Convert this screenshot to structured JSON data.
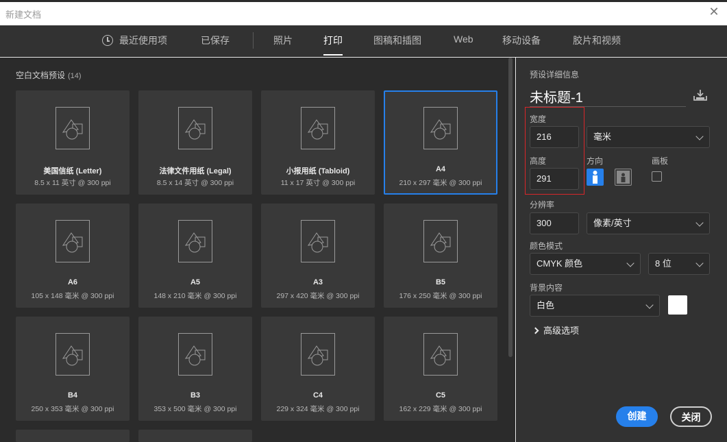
{
  "window": {
    "title": "新建文档",
    "close_icon": "close-icon"
  },
  "tabs": [
    {
      "label": "最近使用项",
      "icon": "clock-icon",
      "active": false
    },
    {
      "label": "已保存",
      "active": false
    },
    {
      "label": "照片",
      "active": false
    },
    {
      "label": "打印",
      "active": true
    },
    {
      "label": "图稿和插图",
      "active": false
    },
    {
      "label": "Web",
      "active": false
    },
    {
      "label": "移动设备",
      "active": false
    },
    {
      "label": "胶片和视频",
      "active": false
    }
  ],
  "presets": {
    "heading": "空白文档预设",
    "count": "(14)",
    "items": [
      {
        "name": "美国信纸 (Letter)",
        "size": "8.5 x 11 英寸 @ 300 ppi",
        "selected": false
      },
      {
        "name": "法律文件用纸 (Legal)",
        "size": "8.5 x 14 英寸 @ 300 ppi",
        "selected": false
      },
      {
        "name": "小报用纸 (Tabloid)",
        "size": "11 x 17 英寸 @ 300 ppi",
        "selected": false
      },
      {
        "name": "A4",
        "size": "210 x 297 毫米 @ 300 ppi",
        "selected": true
      },
      {
        "name": "A6",
        "size": "105 x 148 毫米 @ 300 ppi",
        "selected": false
      },
      {
        "name": "A5",
        "size": "148 x 210 毫米 @ 300 ppi",
        "selected": false
      },
      {
        "name": "A3",
        "size": "297 x 420 毫米 @ 300 ppi",
        "selected": false
      },
      {
        "name": "B5",
        "size": "176 x 250 毫米 @ 300 ppi",
        "selected": false
      },
      {
        "name": "B4",
        "size": "250 x 353 毫米 @ 300 ppi",
        "selected": false
      },
      {
        "name": "B3",
        "size": "353 x 500 毫米 @ 300 ppi",
        "selected": false
      },
      {
        "name": "C4",
        "size": "229 x 324 毫米 @ 300 ppi",
        "selected": false
      },
      {
        "name": "C5",
        "size": "162 x 229 毫米 @ 300 ppi",
        "selected": false
      }
    ]
  },
  "details": {
    "heading": "预设详细信息",
    "doc_name": "未标题-1",
    "width_label": "宽度",
    "width_value": "216",
    "unit": "毫米",
    "height_label": "高度",
    "height_value": "291",
    "orientation_label": "方向",
    "artboard_label": "画板",
    "resolution_label": "分辨率",
    "resolution_value": "300",
    "resolution_unit": "像素/英寸",
    "color_mode_label": "颜色模式",
    "color_mode": "CMYK 颜色",
    "bit_depth": "8 位",
    "background_label": "背景内容",
    "background": "白色",
    "background_color": "#ffffff",
    "advanced": "高级选项"
  },
  "buttons": {
    "create": "创建",
    "close": "关闭"
  },
  "colors": {
    "accent": "#2680eb",
    "highlight_box": "#d9262a"
  }
}
